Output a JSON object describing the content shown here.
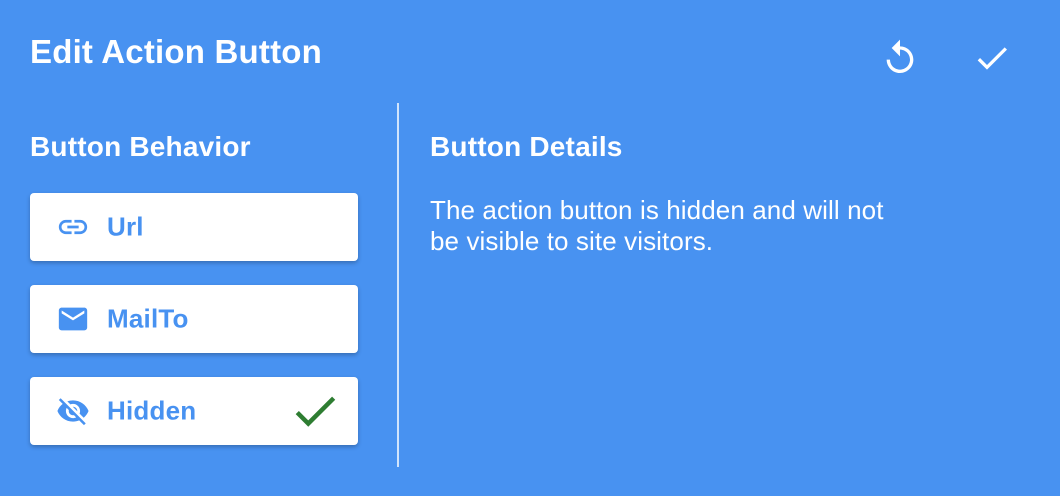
{
  "header": {
    "title": "Edit Action Button",
    "actions": [
      {
        "name": "reset",
        "icon": "reset-icon"
      },
      {
        "name": "confirm",
        "icon": "check-icon"
      }
    ]
  },
  "behavior": {
    "heading": "Button Behavior",
    "options": [
      {
        "label": "Url",
        "icon": "link-icon",
        "selected": false
      },
      {
        "label": "MailTo",
        "icon": "mail-icon",
        "selected": false
      },
      {
        "label": "Hidden",
        "icon": "eye-off-icon",
        "selected": true
      }
    ]
  },
  "details": {
    "heading": "Button Details",
    "text": "The action button is hidden and will not be visible to site visitors."
  },
  "colors": {
    "background": "#4892f1",
    "option_text": "#4892f1",
    "selected_check": "#2e7d32"
  }
}
